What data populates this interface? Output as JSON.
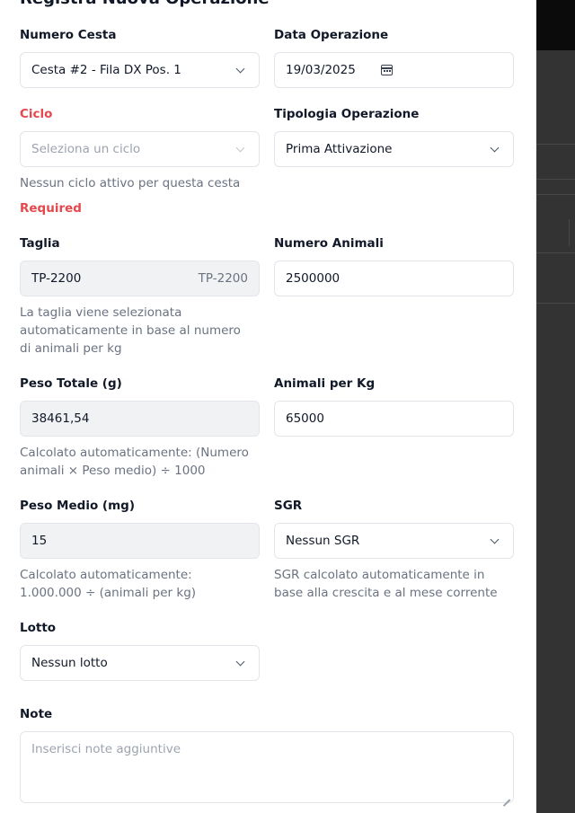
{
  "form": {
    "title": "Registra Nuova Operazione",
    "numero_cesta": {
      "label": "Numero Cesta",
      "value": "Cesta #2 - Fila DX Pos. 1"
    },
    "data_operazione": {
      "label": "Data Operazione",
      "value": "19/03/2025"
    },
    "ciclo": {
      "label": "Ciclo",
      "placeholder": "Seleziona un ciclo",
      "help": "Nessun ciclo attivo per questa cesta",
      "error": "Required"
    },
    "tipologia": {
      "label": "Tipologia Operazione",
      "value": "Prima Attivazione"
    },
    "taglia": {
      "label": "Taglia",
      "value": "TP-2200",
      "badge": "TP-2200",
      "help": "La taglia viene selezionata automaticamente in base al numero di animali per kg"
    },
    "numero_animali": {
      "label": "Numero Animali",
      "value": "2500000"
    },
    "peso_totale": {
      "label": "Peso Totale (g)",
      "value": "38461,54",
      "help": "Calcolato automaticamente: (Numero animali × Peso medio) ÷ 1000"
    },
    "animali_per_kg": {
      "label": "Animali per Kg",
      "value": "65000"
    },
    "peso_medio": {
      "label": "Peso Medio (mg)",
      "value": "15",
      "help": "Calcolato automaticamente: 1.000.000 ÷ (animali per kg)"
    },
    "sgr": {
      "label": "SGR",
      "value": "Nessun SGR",
      "help": "SGR calcolato automaticamente in base alla crescita e al mese corrente"
    },
    "lotto": {
      "label": "Lotto",
      "value": "Nessun lotto"
    },
    "note": {
      "label": "Note",
      "placeholder": "Inserisci note aggiuntive"
    }
  },
  "icons": {
    "select": "chevron-down-icon",
    "date": "calendar-icon",
    "textarea": "resize-grip-icon"
  },
  "colors": {
    "error": "#e5484d",
    "border": "#e2e5ea",
    "readonly_bg": "#f1f2f4",
    "help_text": "#6b7280",
    "backdrop": "#333333"
  }
}
